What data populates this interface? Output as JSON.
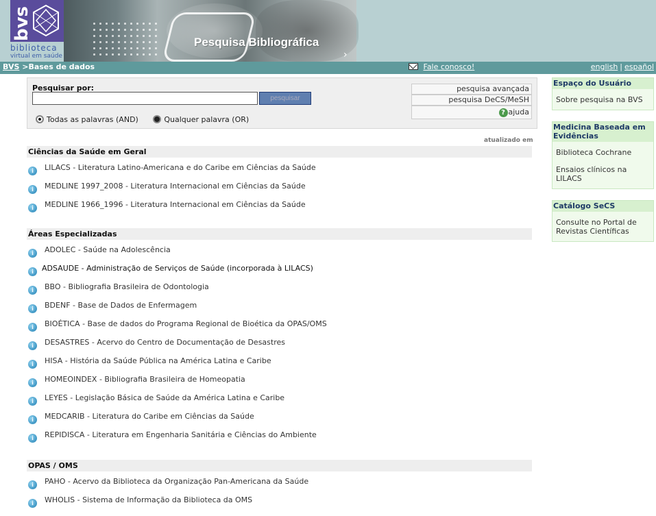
{
  "header": {
    "logo_mark": "bvs",
    "logo_word1": "biblioteca",
    "logo_word2": "virtual em saúde",
    "title": "Pesquisa Bibliográfica"
  },
  "nav": {
    "home_link": "BVS",
    "separator": ">",
    "current": "Bases de dados",
    "contact": "Fale conosco!",
    "lang_en": "english",
    "lang_sep": "|",
    "lang_es": "español"
  },
  "search": {
    "label": "Pesquisar por:",
    "input_value": "",
    "button_label": "pesquisar",
    "mode_and": "Todas as palavras (AND)",
    "mode_or": "Qualquer palavra (OR)",
    "advanced": "pesquisa avançada",
    "decs": "pesquisa DeCS/MeSH",
    "help": "ajuda"
  },
  "updated_label": "atualizado em",
  "sections": [
    {
      "title": "Ciências da Saúde em Geral",
      "items": [
        "LILACS - Literatura Latino-Americana e do Caribe em Ciências da Saúde",
        "MEDLINE 1997_2008 - Literatura Internacional em Ciências da Saúde",
        "MEDLINE 1966_1996 - Literatura Internacional em Ciências da Saúde"
      ]
    },
    {
      "title": "Áreas Especializadas",
      "items": [
        "ADOLEC - Saúde na Adolescência",
        "ADSAUDE - Administração de Serviços de Saúde (incorporada à LILACS)",
        "BBO - Bibliografia Brasileira de Odontologia",
        "BDENF - Base de Dados de Enfermagem",
        "BIOÉTICA - Base de dados do Programa Regional de Bioética da OPAS/OMS",
        "DESASTRES - Acervo do Centro de Documentação de Desastres",
        "HISA - História da Saúde Pública na América Latina e Caribe",
        "HOMEOINDEX - Bibliografia Brasileira de Homeopatia",
        "LEYES - Legislação Básica de Saúde da América Latina e Caribe",
        "MEDCARIB - Literatura do Caribe em Ciências da Saúde",
        "REPIDISCA - Literatura em Engenharia Sanitária e Ciências do Ambiente"
      ]
    },
    {
      "title": "OPAS / OMS",
      "items": [
        "PAHO - Acervo da Biblioteca da Organização Pan-Americana da Saúde",
        "WHOLIS - Sistema de Informação da Biblioteca da OMS"
      ]
    }
  ],
  "sidebar": [
    {
      "title": "Espaço do Usuário",
      "entries": [
        "Sobre pesquisa na BVS"
      ]
    },
    {
      "title": "Medicina Baseada em Evidências",
      "entries": [
        "Biblioteca Cochrane",
        "Ensaios clínicos na LILACS"
      ]
    },
    {
      "title": "Catálogo SeCS",
      "entries": [
        "Consulte no Portal de Revistas Científicas"
      ]
    }
  ]
}
